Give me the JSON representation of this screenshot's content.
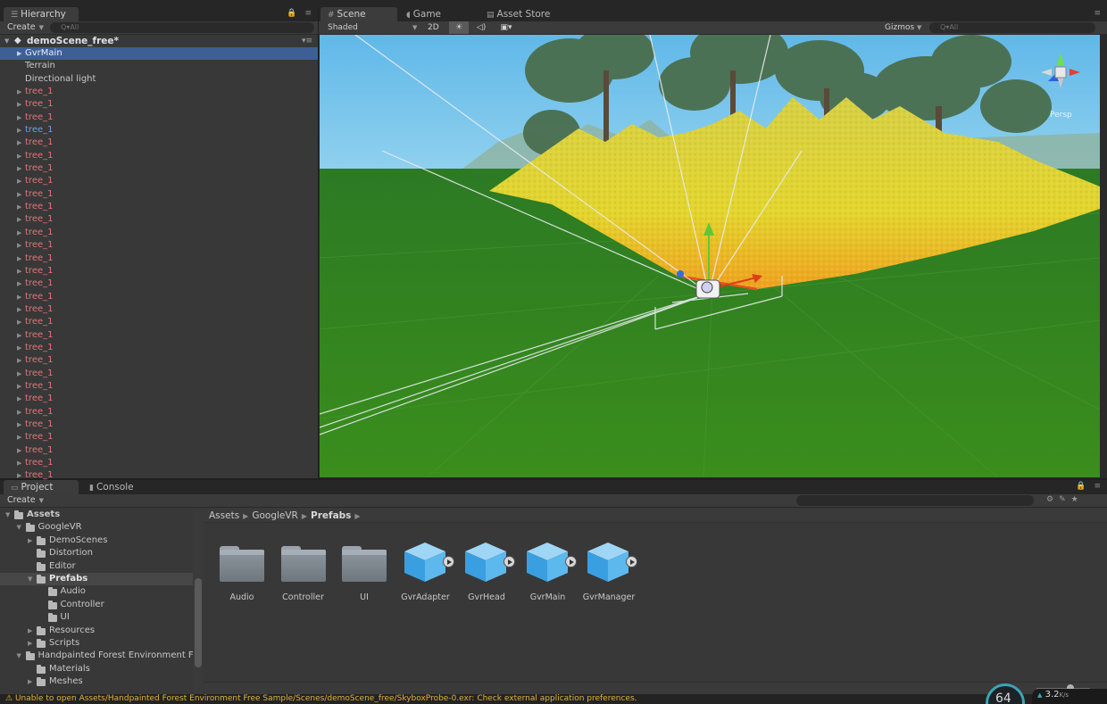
{
  "hierarchy": {
    "tab_label": "Hierarchy",
    "create_label": "Create",
    "search_placeholder": "Q▾All",
    "scene_name": "demoScene_free*",
    "items": [
      {
        "label": "GvrMain",
        "kind": "selected",
        "expandable": true
      },
      {
        "label": "Terrain",
        "kind": "plain",
        "expandable": false
      },
      {
        "label": "Directional light",
        "kind": "plain",
        "expandable": false
      },
      {
        "label": "tree_1",
        "kind": "tree"
      },
      {
        "label": "tree_1",
        "kind": "tree"
      },
      {
        "label": "tree_1",
        "kind": "tree"
      },
      {
        "label": "tree_1",
        "kind": "treeblue"
      },
      {
        "label": "tree_1",
        "kind": "tree"
      },
      {
        "label": "tree_1",
        "kind": "tree"
      },
      {
        "label": "tree_1",
        "kind": "tree"
      },
      {
        "label": "tree_1",
        "kind": "tree"
      },
      {
        "label": "tree_1",
        "kind": "tree"
      },
      {
        "label": "tree_1",
        "kind": "tree"
      },
      {
        "label": "tree_1",
        "kind": "tree"
      },
      {
        "label": "tree_1",
        "kind": "tree"
      },
      {
        "label": "tree_1",
        "kind": "tree"
      },
      {
        "label": "tree_1",
        "kind": "tree"
      },
      {
        "label": "tree_1",
        "kind": "tree"
      },
      {
        "label": "tree_1",
        "kind": "tree"
      },
      {
        "label": "tree_1",
        "kind": "tree"
      },
      {
        "label": "tree_1",
        "kind": "tree"
      },
      {
        "label": "tree_1",
        "kind": "tree"
      },
      {
        "label": "tree_1",
        "kind": "tree"
      },
      {
        "label": "tree_1",
        "kind": "tree"
      },
      {
        "label": "tree_1",
        "kind": "tree"
      },
      {
        "label": "tree_1",
        "kind": "tree"
      },
      {
        "label": "tree_1",
        "kind": "tree"
      },
      {
        "label": "tree_1",
        "kind": "tree"
      },
      {
        "label": "tree_1",
        "kind": "tree"
      },
      {
        "label": "tree_1",
        "kind": "tree"
      },
      {
        "label": "tree_1",
        "kind": "tree"
      },
      {
        "label": "tree_1",
        "kind": "tree"
      },
      {
        "label": "tree_1",
        "kind": "tree"
      },
      {
        "label": "tree_1",
        "kind": "tree"
      }
    ]
  },
  "scene": {
    "tabs": [
      {
        "label": "Scene",
        "icon": "grid-icon"
      },
      {
        "label": "Game",
        "icon": "pacman-icon"
      },
      {
        "label": "Asset Store",
        "icon": "bag-icon"
      }
    ],
    "shading_mode": "Shaded",
    "mode_2d": "2D",
    "gizmos_label": "Gizmos",
    "search_placeholder": "Q▾All",
    "persp_label": "Persp",
    "colors": {
      "sky": "#7fc6ea",
      "ground": "#2f7d22",
      "terrain": "#d8d03a"
    }
  },
  "project": {
    "tabs": [
      {
        "label": "Project",
        "icon": "folder-icon"
      },
      {
        "label": "Console",
        "icon": "console-icon"
      }
    ],
    "create_label": "Create",
    "tree": [
      {
        "label": "Assets",
        "level": 0,
        "expanded": true,
        "bold": true
      },
      {
        "label": "GoogleVR",
        "level": 1,
        "expanded": true
      },
      {
        "label": "DemoScenes",
        "level": 2,
        "expandable": true
      },
      {
        "label": "Distortion",
        "level": 2
      },
      {
        "label": "Editor",
        "level": 2
      },
      {
        "label": "Prefabs",
        "level": 2,
        "expanded": true,
        "bold": true,
        "selected": true
      },
      {
        "label": "Audio",
        "level": 3
      },
      {
        "label": "Controller",
        "level": 3
      },
      {
        "label": "UI",
        "level": 3
      },
      {
        "label": "Resources",
        "level": 2,
        "expandable": true
      },
      {
        "label": "Scripts",
        "level": 2,
        "expandable": true
      },
      {
        "label": "Handpainted Forest Environment Free",
        "level": 1,
        "expanded": true
      },
      {
        "label": "Materials",
        "level": 2
      },
      {
        "label": "Meshes",
        "level": 2,
        "expandable": true
      }
    ],
    "breadcrumb": [
      "Assets",
      "GoogleVR",
      "Prefabs"
    ],
    "assets": [
      {
        "label": "Audio",
        "type": "folder"
      },
      {
        "label": "Controller",
        "type": "folder"
      },
      {
        "label": "UI",
        "type": "folder"
      },
      {
        "label": "GvrAdapter",
        "type": "prefab"
      },
      {
        "label": "GvrHead",
        "type": "prefab"
      },
      {
        "label": "GvrMain",
        "type": "prefab"
      },
      {
        "label": "GvrManager",
        "type": "prefab"
      }
    ]
  },
  "status": {
    "message": "Unable to open Assets/Handpainted Forest Environment Free Sample/Scenes/demoScene_free/SkyboxProbe-0.exr: Check external application preferences.",
    "fps": "64",
    "net_speed": "3.2",
    "net_unit": "K/s"
  }
}
